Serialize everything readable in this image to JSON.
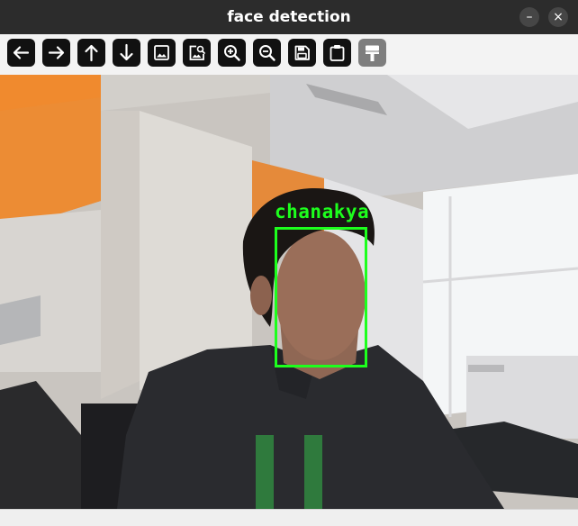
{
  "window": {
    "title": "face detection",
    "minimize_glyph": "–",
    "close_glyph": "×"
  },
  "toolbar": {
    "buttons": [
      {
        "name": "pan-left-button",
        "icon": "arrow-left-icon"
      },
      {
        "name": "pan-right-button",
        "icon": "arrow-right-icon"
      },
      {
        "name": "pan-up-button",
        "icon": "arrow-up-icon"
      },
      {
        "name": "pan-down-button",
        "icon": "arrow-down-icon"
      },
      {
        "name": "zoom-to-window-button",
        "icon": "image-icon"
      },
      {
        "name": "zoom-original-button",
        "icon": "image-search-icon"
      },
      {
        "name": "zoom-in-button",
        "icon": "zoom-in-icon"
      },
      {
        "name": "zoom-out-button",
        "icon": "zoom-out-icon"
      },
      {
        "name": "save-button",
        "icon": "save-icon"
      },
      {
        "name": "copy-to-clipboard-button",
        "icon": "clipboard-icon"
      },
      {
        "name": "properties-button",
        "icon": "paint-roller-icon",
        "disabled": true
      }
    ]
  },
  "detection": {
    "label": "chanakya",
    "box_color": "#1dff1d"
  },
  "colors": {
    "titlebar": "#2c2c2c",
    "toolbar": "#f3f3f3",
    "button": "#111111",
    "button_disabled": "#7e7e7e"
  }
}
